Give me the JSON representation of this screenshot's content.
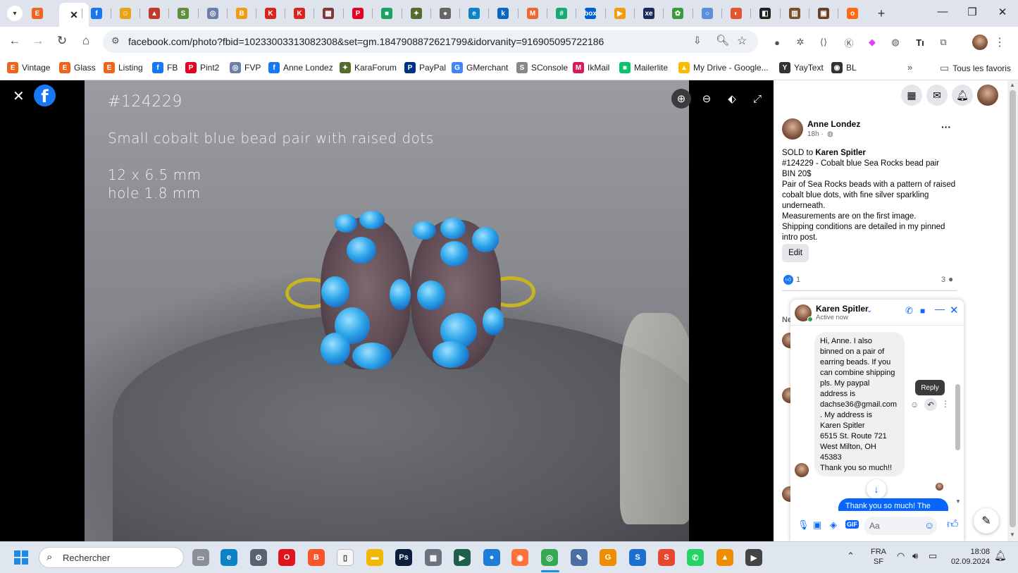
{
  "browser": {
    "url": "facebook.com/photo?fbid=10233003313082308&set=gm.1847908872621799&idorvanity=916905095722186",
    "tabs": [
      {
        "name": "etsy",
        "glyph": "E",
        "color": "#f1641e"
      },
      {
        "name": "facebook-active",
        "glyph": "",
        "color": "#1877f2"
      },
      {
        "name": "facebook",
        "glyph": "f",
        "color": "#1877f2"
      },
      {
        "name": "emoji",
        "glyph": "☺",
        "color": "#e8a317"
      },
      {
        "name": "triangle",
        "glyph": "▲",
        "color": "#c0392b"
      },
      {
        "name": "shopify",
        "glyph": "S",
        "color": "#5e8e3e"
      },
      {
        "name": "circle",
        "glyph": "◎",
        "color": "#6b7fa8"
      },
      {
        "name": "orange",
        "glyph": "B",
        "color": "#f39c12"
      },
      {
        "name": "k-red",
        "glyph": "K",
        "color": "#d9261c"
      },
      {
        "name": "k-red2",
        "glyph": "K",
        "color": "#d9261c"
      },
      {
        "name": "grid",
        "glyph": "▦",
        "color": "#7d3c3c"
      },
      {
        "name": "pinterest",
        "glyph": "P",
        "color": "#e60023"
      },
      {
        "name": "chat",
        "glyph": "■",
        "color": "#1aa260"
      },
      {
        "name": "turtle",
        "glyph": "✦",
        "color": "#556b2f"
      },
      {
        "name": "globe",
        "glyph": "●",
        "color": "#666"
      },
      {
        "name": "edge",
        "glyph": "e",
        "color": "#0a84c6"
      },
      {
        "name": "k-blue",
        "glyph": "k",
        "color": "#0a66c2"
      },
      {
        "name": "magento",
        "glyph": "M",
        "color": "#ee672f"
      },
      {
        "name": "hashtag",
        "glyph": "#",
        "color": "#19a974"
      },
      {
        "name": "box",
        "glyph": "box",
        "color": "#0061d5"
      },
      {
        "name": "play",
        "glyph": "▶",
        "color": "#f39c12"
      },
      {
        "name": "xe",
        "glyph": "xe",
        "color": "#1a2a5c"
      },
      {
        "name": "frog",
        "glyph": "✿",
        "color": "#3d9940"
      },
      {
        "name": "ring",
        "glyph": "○",
        "color": "#5d8fd6"
      },
      {
        "name": "swirl",
        "glyph": "◐",
        "color": "#e4572e"
      },
      {
        "name": "dark",
        "glyph": "◧",
        "color": "#222"
      },
      {
        "name": "books",
        "glyph": "▥",
        "color": "#7a5230"
      },
      {
        "name": "photo",
        "glyph": "▣",
        "color": "#6b3f2a"
      },
      {
        "name": "o-orange",
        "glyph": "o",
        "color": "#ff6a13"
      }
    ],
    "new_tab": "+",
    "bookmarks": [
      {
        "label": "Vintage",
        "icon": "E",
        "color": "#f1641e"
      },
      {
        "label": "Glass",
        "icon": "E",
        "color": "#f1641e"
      },
      {
        "label": "Listing",
        "icon": "E",
        "color": "#f1641e"
      },
      {
        "label": "FB",
        "icon": "f",
        "color": "#1877f2"
      },
      {
        "label": "Pint2",
        "icon": "P",
        "color": "#e60023"
      },
      {
        "label": "FVP",
        "icon": "◎",
        "color": "#6b7fa8"
      },
      {
        "label": "Anne Londez",
        "icon": "f",
        "color": "#1877f2"
      },
      {
        "label": "KaraForum",
        "icon": "✦",
        "color": "#556b2f"
      },
      {
        "label": "PayPal",
        "icon": "P",
        "color": "#003087"
      },
      {
        "label": "GMerchant",
        "icon": "G",
        "color": "#4285f4"
      },
      {
        "label": "SConsole",
        "icon": "S",
        "color": "#888"
      },
      {
        "label": "IkMail",
        "icon": "M",
        "color": "#d81b60"
      },
      {
        "label": "Mailerlite",
        "icon": "■",
        "color": "#09c269"
      },
      {
        "label": "My Drive - Google...",
        "icon": "▲",
        "color": "#fbbc04"
      },
      {
        "label": "YayText",
        "icon": "Y",
        "color": "#333"
      },
      {
        "label": "BL",
        "icon": "◉",
        "color": "#333"
      }
    ],
    "all_bookmarks": "Tous les favoris"
  },
  "photo": {
    "number": "#124229",
    "title": "Small cobalt blue bead pair with raised dots",
    "size": "12 x 6.5 mm",
    "hole": "hole 1.8 mm"
  },
  "post": {
    "author": "Anne Londez",
    "time": "18h ·",
    "sold_prefix": "SOLD to ",
    "sold_to": "Karen Spitler",
    "lines": [
      "#124229 - Cobalt blue Sea Rocks bead pair",
      "BIN 20$",
      "Pair of Sea Rocks beads with a pattern of raised cobalt blue dots, with fine silver sparkling underneath.",
      "Measurements are on the first image.",
      "Shipping conditions are detailed in my pinned intro post."
    ],
    "edit_label": "Edit",
    "likes": "1",
    "comments": "3",
    "comments_heading": "Ne"
  },
  "chat": {
    "name": "Karen Spitler",
    "status": "Active now",
    "message_lines": [
      "Hi, Anne. I also",
      "binned on a pair of",
      "earring beads. If you",
      "can combine shipping",
      "pls. My paypal",
      "address is",
      "dachse36@gmail.com",
      ". My address is",
      "Karen Spitler",
      "6515 St. Route 721",
      "West Milton, OH",
      "45383",
      "Thank you so much!!"
    ],
    "reply_tooltip": "Reply",
    "outgoing_preview": "Thank you so much! The",
    "input_placeholder": "Aa"
  },
  "taskbar": {
    "search_placeholder": "Rechercher",
    "lang_top": "FRA",
    "lang_bottom": "SF",
    "time": "18:08",
    "date": "02.09.2024",
    "apps": [
      {
        "name": "file-explorer-small",
        "glyph": "▭",
        "color": "#8a8f99"
      },
      {
        "name": "edge",
        "glyph": "e",
        "color": "#0a84c6"
      },
      {
        "name": "settings",
        "glyph": "⚙",
        "color": "#5a6270"
      },
      {
        "name": "opera",
        "glyph": "O",
        "color": "#e0151b"
      },
      {
        "name": "brave",
        "glyph": "B",
        "color": "#fb542b"
      },
      {
        "name": "notepad",
        "glyph": "▯",
        "color": "#f5f5f5"
      },
      {
        "name": "explorer",
        "glyph": "▬",
        "color": "#f2b705"
      },
      {
        "name": "photoshop",
        "glyph": "Ps",
        "color": "#0a1f3c"
      },
      {
        "name": "calculator",
        "glyph": "▦",
        "color": "#6b7280"
      },
      {
        "name": "terminal",
        "glyph": "▶",
        "color": "#1f5f4a"
      },
      {
        "name": "app-blue",
        "glyph": "●",
        "color": "#1c7ed6"
      },
      {
        "name": "firefox",
        "glyph": "◉",
        "color": "#ff7139"
      },
      {
        "name": "chrome",
        "glyph": "◎",
        "color": "#34a853"
      },
      {
        "name": "feather",
        "glyph": "✎",
        "color": "#4a6fa5"
      },
      {
        "name": "app-orange",
        "glyph": "G",
        "color": "#f08c00"
      },
      {
        "name": "s-blue",
        "glyph": "S",
        "color": "#1c6fd1"
      },
      {
        "name": "s-red",
        "glyph": "S",
        "color": "#e8472f"
      },
      {
        "name": "whatsapp",
        "glyph": "✆",
        "color": "#25d366"
      },
      {
        "name": "vlc",
        "glyph": "▲",
        "color": "#f08c00"
      },
      {
        "name": "media",
        "glyph": "▶",
        "color": "#444"
      }
    ]
  }
}
